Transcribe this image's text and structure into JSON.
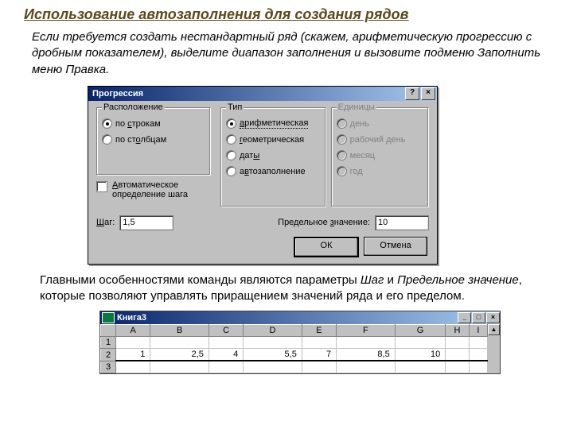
{
  "page": {
    "title": "Использование автозаполнения для создания рядов",
    "intro": "Если требуется создать нестандартный ряд (скажем, арифметическую прогрессию с дробным показателем), выделите диапазон заполнения и вызовите подменю Заполнить меню Правка.",
    "para2_pre": "Главными особенностями команды являются параметры ",
    "para2_em1": "Шаг",
    "para2_mid": " и ",
    "para2_em2": "Предельное значение",
    "para2_post": ", которые позволяют управлять приращением значений ряда и его пределом."
  },
  "dialog": {
    "title": "Прогрессия",
    "help": "?",
    "close": "×",
    "group_location": {
      "title": "Расположение",
      "opts": [
        "по строкам",
        "по столбцам"
      ],
      "hot": [
        "с",
        "ст"
      ],
      "selected": 0
    },
    "group_type": {
      "title": "Тип",
      "opts": [
        "арифметическая",
        "геометрическая",
        "даты",
        "автозаполнение"
      ],
      "hot": [
        "а",
        "г",
        "ы",
        "а"
      ],
      "selected": 0
    },
    "group_units": {
      "title": "Единицы",
      "opts": [
        "день",
        "рабочий день",
        "месяц",
        "год"
      ]
    },
    "auto_step": {
      "label": "Автоматическое определение шага",
      "hot": "А"
    },
    "step_label": "Шаг:",
    "step_hot": "Ш",
    "step_value": "1,5",
    "limit_label": "Предельное значение:",
    "limit_hot": "з",
    "limit_value": "10",
    "ok": "ОК",
    "cancel": "Отмена"
  },
  "sheet": {
    "title": "Книга3",
    "cols": [
      "A",
      "B",
      "C",
      "D",
      "E",
      "F",
      "G",
      "H",
      "I"
    ],
    "rows": [
      "1",
      "2",
      "3"
    ],
    "row2_values": [
      "1",
      "2,5",
      "4",
      "5,5",
      "7",
      "8,5",
      "10",
      "",
      ""
    ]
  }
}
